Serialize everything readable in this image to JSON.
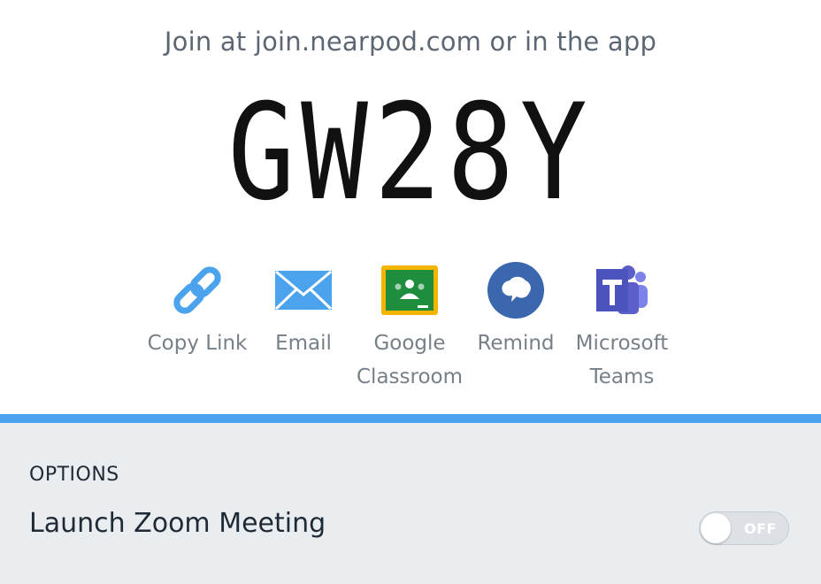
{
  "header": {
    "join_text": "Join at join.nearpod.com or in the app",
    "code": "GW28Y"
  },
  "share": {
    "copy_link": {
      "label": "Copy Link",
      "icon": "link-icon",
      "color": "#4aa3ec"
    },
    "email": {
      "label": "Email",
      "icon": "envelope-icon",
      "color": "#4aa3ec"
    },
    "google_classroom": {
      "label": "Google\nClassroom",
      "icon": "google-classroom-icon",
      "color": "#1e8e3e"
    },
    "remind": {
      "label": "Remind",
      "icon": "remind-icon",
      "color": "#3a67ad"
    },
    "microsoft_teams": {
      "label": "Microsoft\nTeams",
      "icon": "microsoft-teams-icon",
      "color": "#5b5fc7"
    }
  },
  "options": {
    "heading": "OPTIONS",
    "launch_zoom": {
      "label": "Launch Zoom Meeting",
      "toggle_state": "OFF"
    }
  },
  "colors": {
    "accent_bar": "#4aa3ec",
    "options_background": "#e9edf0"
  }
}
